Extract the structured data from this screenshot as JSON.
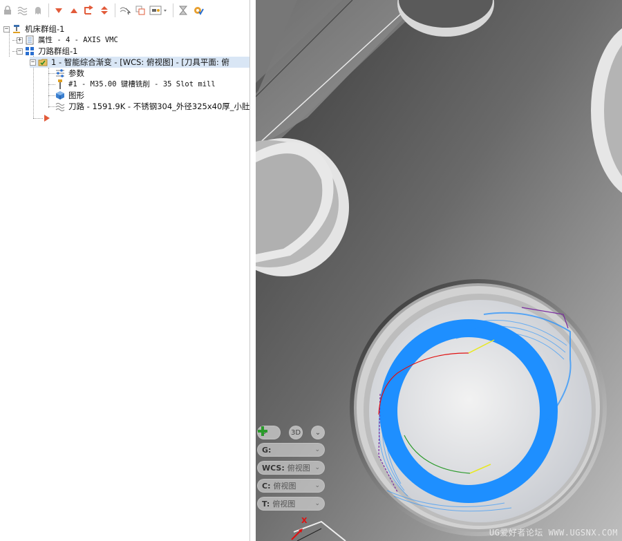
{
  "toolbar": {
    "icons": [
      "lock-icon",
      "wave-icon",
      "ghost-icon",
      "arrow-down-icon",
      "arrow-up-icon",
      "redirect-icon",
      "up-down-icon",
      "select-path-icon",
      "copy-icon",
      "display-options-icon",
      "hourglass-icon",
      "gear-check-icon"
    ]
  },
  "tree": {
    "root": "机床群组-1",
    "properties": "属性 - 4 - AXIS VMC",
    "toolpath_group": "刀路群组-1",
    "operation": "1 - 智能综合渐变 - [WCS: 俯视图] - [刀具平面: 俯",
    "params": "参数",
    "tool": "#1 - M35.00 键槽铣削 - 35 Slot mill",
    "geometry": "图形",
    "toolpath": "刀路 - 1591.9K - 不锈钢304_外径325x40厚_小肚"
  },
  "viewport": {
    "btn_3d": "3D",
    "g_label": "G:",
    "wcs_label": "WCS:",
    "wcs_value": "俯视图",
    "c_label": "C:",
    "c_value": "俯视图",
    "t_label": "T:",
    "t_value": "俯视图",
    "axis_x": "X",
    "watermark": "UG爱好者论坛 WWW.UGSNX.COM",
    "colors": {
      "toolpath": "#1e8fff",
      "entry": "#e01010",
      "exit": "#2a9a2a",
      "link": "#e8e820"
    }
  }
}
